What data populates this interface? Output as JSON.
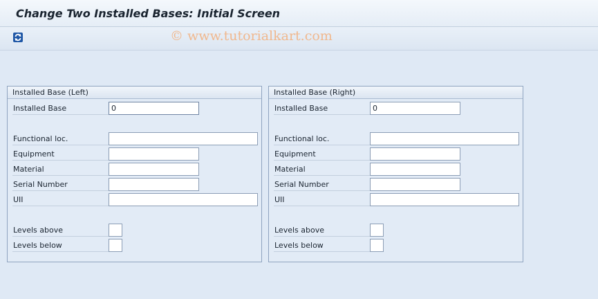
{
  "header": {
    "title": "Change Two Installed Bases: Initial Screen"
  },
  "toolbar": {
    "refresh_icon": "refresh-icon"
  },
  "watermark": "© www.tutorialkart.com",
  "left": {
    "title": "Installed Base (Left)",
    "fields": {
      "installed_base": {
        "label": "Installed Base",
        "value": "0"
      },
      "functional_loc": {
        "label": "Functional loc.",
        "value": ""
      },
      "equipment": {
        "label": "Equipment",
        "value": ""
      },
      "material": {
        "label": "Material",
        "value": ""
      },
      "serial_number": {
        "label": "Serial Number",
        "value": ""
      },
      "uii": {
        "label": "UII",
        "value": ""
      },
      "levels_above": {
        "label": "Levels above",
        "value": ""
      },
      "levels_below": {
        "label": "Levels below",
        "value": ""
      }
    }
  },
  "right": {
    "title": "Installed Base (Right)",
    "fields": {
      "installed_base": {
        "label": "Installed Base",
        "value": "0"
      },
      "functional_loc": {
        "label": "Functional loc.",
        "value": ""
      },
      "equipment": {
        "label": "Equipment",
        "value": ""
      },
      "material": {
        "label": "Material",
        "value": ""
      },
      "serial_number": {
        "label": "Serial Number",
        "value": ""
      },
      "uii": {
        "label": "UII",
        "value": ""
      },
      "levels_above": {
        "label": "Levels above",
        "value": ""
      },
      "levels_below": {
        "label": "Levels below",
        "value": ""
      }
    }
  }
}
